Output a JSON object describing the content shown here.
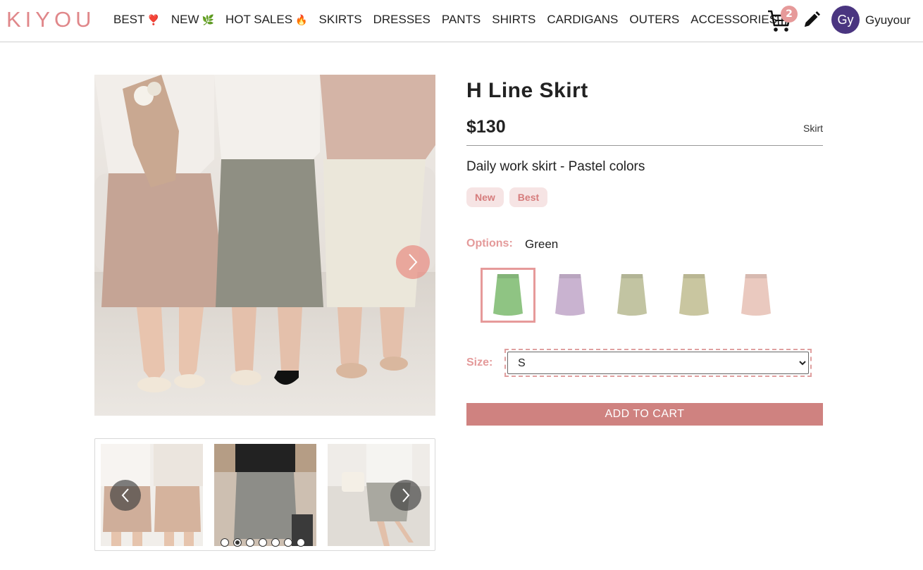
{
  "header": {
    "logo": "KIYOU",
    "nav": [
      {
        "label": "BEST",
        "emoji": "❣️"
      },
      {
        "label": "NEW",
        "emoji": "🌿"
      },
      {
        "label": "HOT SALES",
        "emoji": "🔥"
      },
      {
        "label": "SKIRTS",
        "emoji": ""
      },
      {
        "label": "DRESSES",
        "emoji": ""
      },
      {
        "label": "PANTS",
        "emoji": ""
      },
      {
        "label": "SHIRTS",
        "emoji": ""
      },
      {
        "label": "CARDIGANS",
        "emoji": ""
      },
      {
        "label": "OUTERS",
        "emoji": ""
      },
      {
        "label": "ACCESSORIES",
        "emoji": ""
      }
    ],
    "cart_count": "2",
    "avatar_initials": "Gy",
    "username": "Gyuyour"
  },
  "product": {
    "title": "H Line Skirt",
    "price": "$130",
    "category": "Skirt",
    "description": "Daily work skirt - Pastel colors",
    "tags": [
      "New",
      "Best"
    ],
    "options_label": "Options:",
    "selected_option": "Green",
    "swatches": [
      {
        "color": "#8fc483",
        "selected": true
      },
      {
        "color": "#c9b3d0",
        "selected": false
      },
      {
        "color": "#c2c4a2",
        "selected": false
      },
      {
        "color": "#c9c6a0",
        "selected": false
      },
      {
        "color": "#eac9bf",
        "selected": false
      }
    ],
    "size_label": "Size:",
    "size_options": [
      "S"
    ],
    "selected_size": "S",
    "add_to_cart": "ADD TO CART"
  },
  "gallery": {
    "dot_count": 7,
    "active_dot": 1
  },
  "colors": {
    "accent": "#e69a9a",
    "button": "#cf8280",
    "logo": "#e0878a"
  }
}
